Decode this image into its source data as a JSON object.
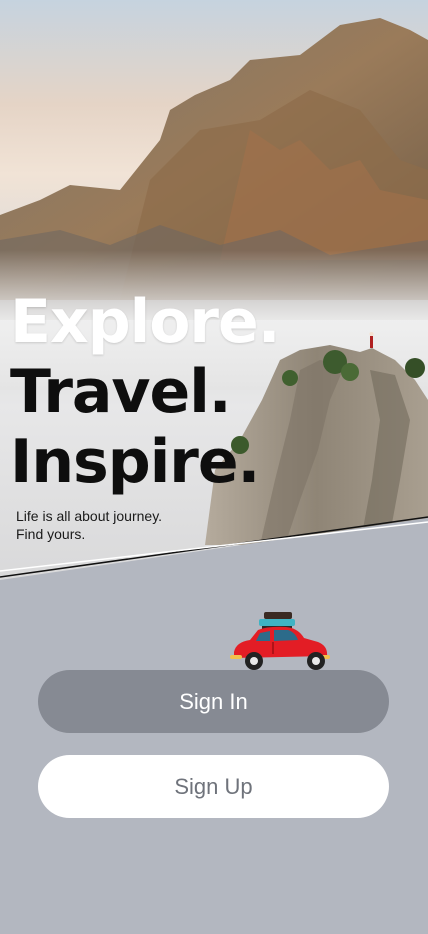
{
  "hero": {
    "headline": [
      "Explore.",
      "Travel.",
      "Inspire."
    ],
    "tagline": "Life is all about journey.\nFind yours."
  },
  "illustration": {
    "icon": "car-with-luggage-icon",
    "body_color": "#e31d25"
  },
  "actions": {
    "sign_in_label": "Sign In",
    "sign_up_label": "Sign Up"
  },
  "colors": {
    "background": "#b3b7c0",
    "sign_in_bg": "#868a93",
    "sign_up_bg": "#ffffff"
  }
}
